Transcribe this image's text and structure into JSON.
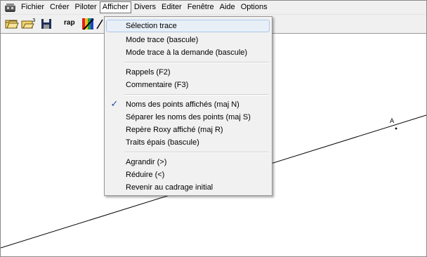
{
  "menubar": {
    "items": [
      "Fichier",
      "Créer",
      "Piloter",
      "Afficher",
      "Divers",
      "Editer",
      "Fenêtre",
      "Aide",
      "Options"
    ]
  },
  "toolbar": {
    "rap_label": "rap"
  },
  "dropdown": {
    "items": [
      {
        "label": "Sélection trace",
        "checked": false
      },
      {
        "label": "Mode trace (bascule)",
        "checked": false
      },
      {
        "label": "Mode trace à la demande (bascule)",
        "checked": false
      },
      {
        "label": "Rappels (F2)",
        "checked": false
      },
      {
        "label": "Commentaire (F3)",
        "checked": false
      },
      {
        "label": "Noms des points affichés (maj N)",
        "checked": true
      },
      {
        "label": "Séparer les noms des points (maj S)",
        "checked": false
      },
      {
        "label": "Repère Roxy affiché (maj R)",
        "checked": false
      },
      {
        "label": "Traits épais (bascule)",
        "checked": false
      },
      {
        "label": "Agrandir (>)",
        "checked": false
      },
      {
        "label": "Réduire (<)",
        "checked": false
      },
      {
        "label": "Revenir au cadrage initial",
        "checked": false
      }
    ],
    "check_mark": "✓"
  },
  "canvas": {
    "point_label": "A"
  },
  "colors": {
    "menu_bg": "#f0f0f0",
    "highlight_bg": "#e8eff7",
    "highlight_border": "#a8c8ea",
    "check_color": "#1c4f9c"
  },
  "icons": [
    "app-icon",
    "open-folder-icon",
    "open-folder-3-icon",
    "save-disk-icon",
    "color-palette-icon",
    "pen-icon"
  ]
}
